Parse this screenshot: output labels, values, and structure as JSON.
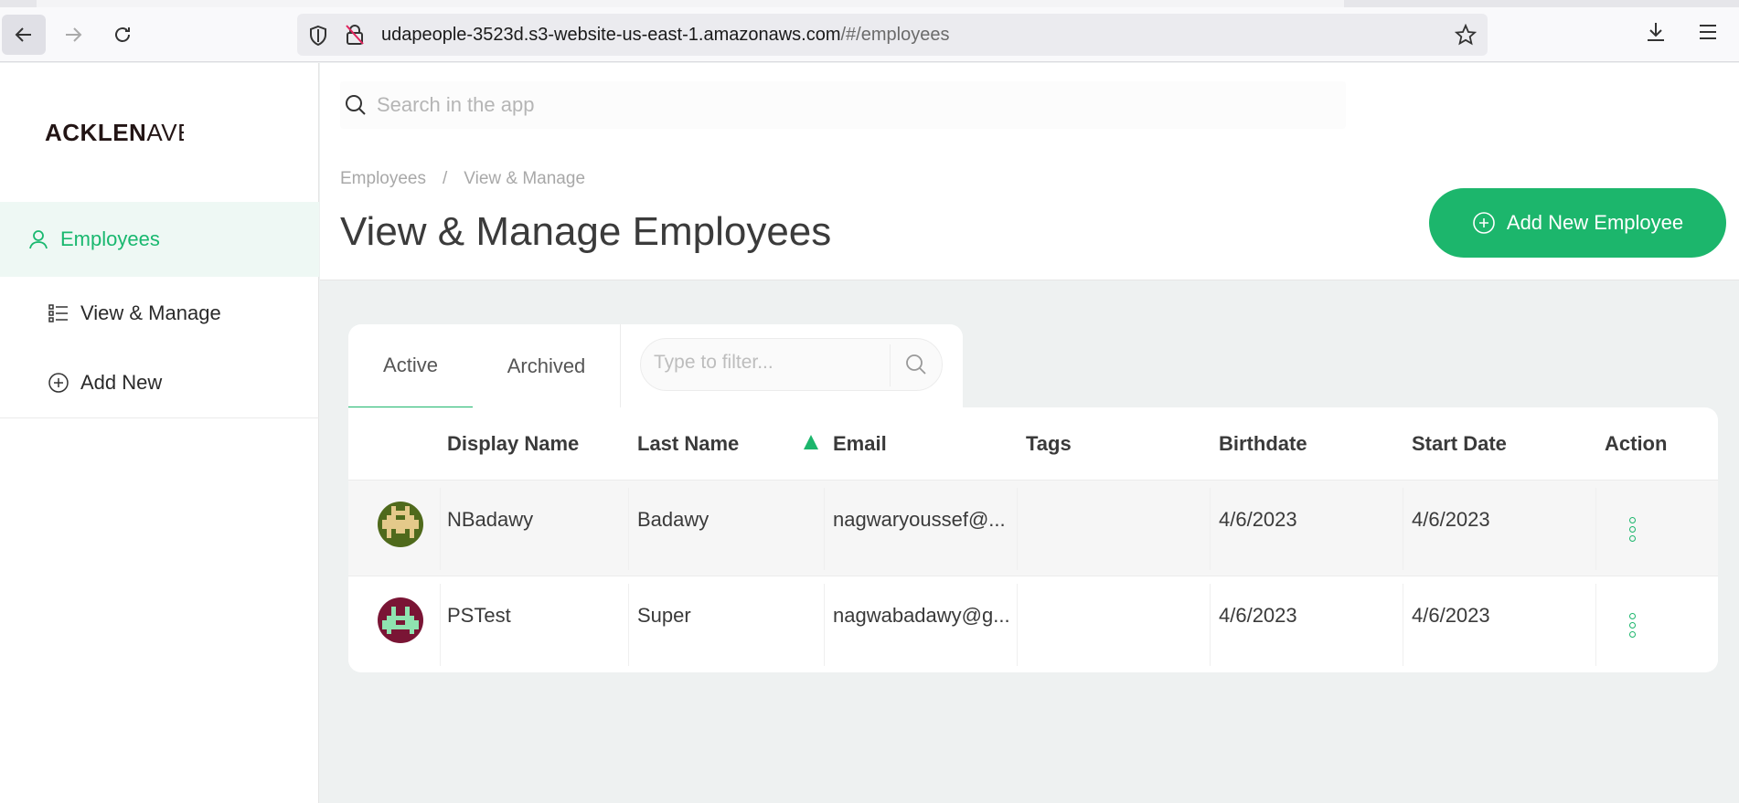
{
  "browser": {
    "url_host": "udapeople-3523d.s3-website-us-east-1.amazonaws.com",
    "url_path": "/#/employees"
  },
  "sidebar": {
    "logo_bold": "ACKLEN",
    "logo_thin": "AVENUE",
    "section": "Employees",
    "items": [
      {
        "label": "View & Manage"
      },
      {
        "label": "Add New"
      }
    ]
  },
  "header": {
    "search_placeholder": "Search in the app",
    "breadcrumb": [
      "Employees",
      "/",
      "View & Manage"
    ],
    "title": "View & Manage Employees",
    "add_button": "Add New Employee"
  },
  "tabs": {
    "active": "Active",
    "archived": "Archived",
    "filter_placeholder": "Type to filter..."
  },
  "table": {
    "columns": [
      "Display Name",
      "Last Name",
      "Email",
      "Tags",
      "Birthdate",
      "Start Date",
      "Action"
    ],
    "sort_column": "Email",
    "rows": [
      {
        "display_name": "NBadawy",
        "last_name": "Badawy",
        "email": "nagwaryoussef@...",
        "tags": "",
        "birthdate": "4/6/2023",
        "start_date": "4/6/2023"
      },
      {
        "display_name": "PSTest",
        "last_name": "Super",
        "email": "nagwabadawy@g...",
        "tags": "",
        "birthdate": "4/6/2023",
        "start_date": "4/6/2023"
      }
    ]
  },
  "colors": {
    "accent": "#1cb66c",
    "avatar1_bg": "#4f6a1c",
    "avatar1_fg": "#e4c98a",
    "avatar2_bg": "#7a1535",
    "avatar2_fg": "#8fe3b0"
  }
}
